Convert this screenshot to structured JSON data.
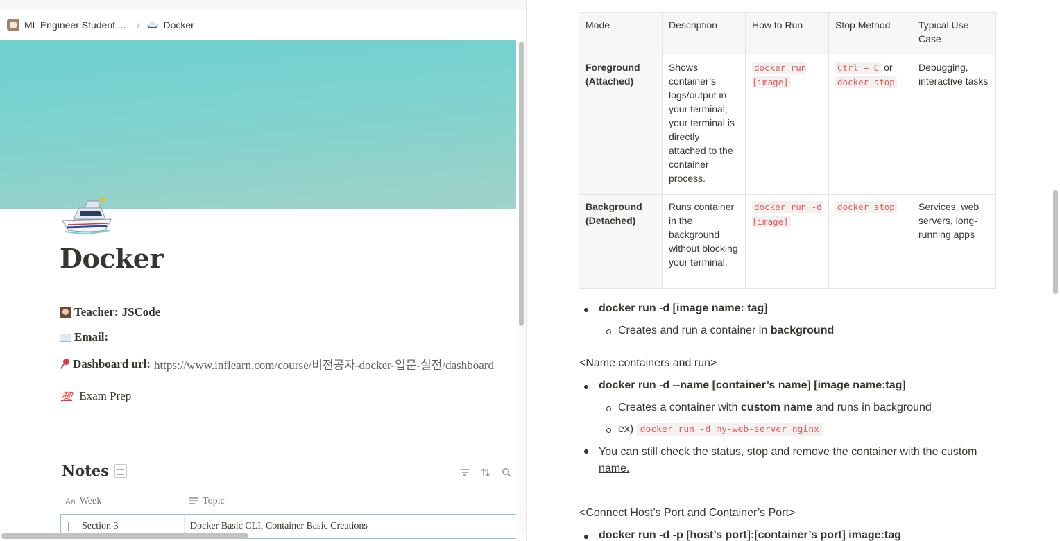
{
  "breadcrumb": {
    "workspace": "ML Engineer Student ...",
    "separator": "/",
    "page": "Docker"
  },
  "page": {
    "title": "Docker",
    "properties": {
      "teacher_label": "Teacher:",
      "teacher_value": "JSCode",
      "email_label": "Email:",
      "dashboard_label": "Dashboard url:",
      "dashboard_url": "https://www.inflearn.com/course/비전공자-docker-입문-실전/dashboard"
    },
    "exam_prep": {
      "icon": "💯",
      "label": "Exam Prep"
    }
  },
  "notes": {
    "title": "Notes",
    "columns": [
      "Week",
      "Topic"
    ],
    "rows": [
      {
        "week": "Section 3",
        "topic": "Docker Basic CLI, Container Basic Creations"
      }
    ]
  },
  "table": {
    "headers": [
      "Mode",
      "Description",
      "How to Run",
      "Stop Method",
      "Typical Use Case"
    ],
    "rows": [
      {
        "mode": "Foreground (Attached)",
        "description": "Shows container’s logs/output in your terminal; your terminal is directly attached to the container process.",
        "run": "docker run [image]",
        "stop_code1": "Ctrl + C",
        "stop_or": "or",
        "stop_code2": "docker stop",
        "use": "Debugging, interactive tasks"
      },
      {
        "mode": "Background (Detached)",
        "description": "Runs container in the background without blocking your terminal.",
        "run": "docker run -d [image]",
        "stop_code1": "docker stop",
        "use": "Services, web servers, long-running apps"
      }
    ]
  },
  "notes_body": {
    "bullet1": "docker run -d [image name: tag]",
    "sub1_pre": "Creates and run a container in ",
    "sub1_bold": "background",
    "heading_name": "<Name containers and run>",
    "bullet2": "docker run -d --name [container’s name] [image name:tag]",
    "sub2_pre": "Creates a container with ",
    "sub2_bold": "custom name",
    "sub2_post": " and runs in background",
    "sub3_pre": "ex) ",
    "sub3_code": "docker run -d my-web-server nginx",
    "bullet3": "You can still check the status, stop and remove the container with the custom name.",
    "heading_port": "<Connect Host’s Port and Container’s Port>",
    "bullet4": "docker run -d -p [host’s port]:[container’s port] image:tag"
  }
}
